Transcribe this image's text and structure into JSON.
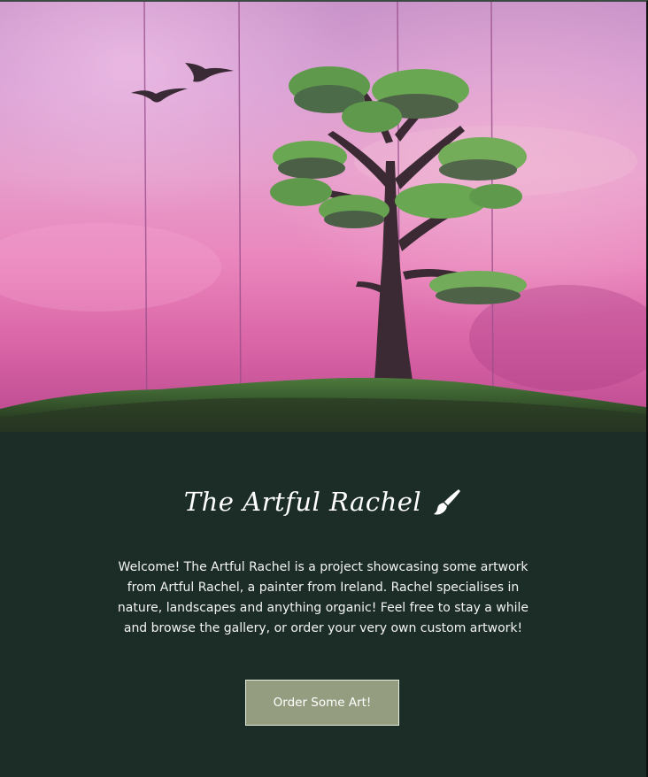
{
  "hero": {
    "image_name": "painting-pink-sky-tree"
  },
  "site": {
    "title": "The Artful Rachel",
    "title_icon": "paintbrush-icon",
    "welcome_text": "Welcome! The Artful Rachel is a project showcasing some artwork from Artful Rachel, a painter from Ireland. Rachel specialises in nature, landscapes and anything organic! Feel free to stay a while and browse the gallery, or order your very own custom artwork!",
    "cta_label": "Order Some Art!"
  },
  "colors": {
    "background": "#1b2d26",
    "button": "#959d80",
    "text": "#ffffff"
  }
}
